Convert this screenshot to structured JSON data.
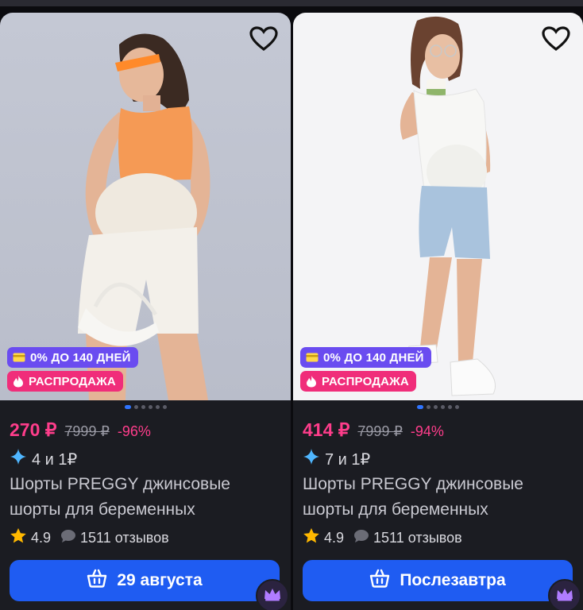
{
  "cards": [
    {
      "price": "270 ₽",
      "old_price": "7999 ₽",
      "discount": "-96%",
      "bonus": "4 и 1₽",
      "title": "Шорты PREGGY джинсовые шорты для беременных",
      "rating": "4.9",
      "reviews": "1511 отзывов",
      "badges": {
        "installment": "0% ДО 140 ДНЕЙ",
        "sale": "РАСПРОДАЖА"
      },
      "cta_label": "29 августа",
      "photo_background": "#c4c8d4"
    },
    {
      "price": "414 ₽",
      "old_price": "7999 ₽",
      "discount": "-94%",
      "bonus": "7 и 1₽",
      "title": "Шорты PREGGY джинсовые шорты для беременных",
      "rating": "4.9",
      "reviews": "1511 отзывов",
      "badges": {
        "installment": "0% ДО 140 ДНЕЙ",
        "sale": "РАСПРОДАЖА"
      },
      "cta_label": "Послезавтра",
      "photo_background": "#f4f4f6"
    }
  ],
  "icons": [
    "heart-icon",
    "card-icon",
    "fire-icon",
    "sparkle-icon",
    "star-icon",
    "chat-bubble-icon",
    "basket-icon",
    "crown-icon"
  ],
  "colors": {
    "accent_pink": "#ff3d8b",
    "cta_blue": "#1f5cf2",
    "installment_purple": "#6a4cf0",
    "sale_pink": "#f02d7a",
    "star_gold": "#ffb800",
    "card_bg": "#1b1c22"
  }
}
